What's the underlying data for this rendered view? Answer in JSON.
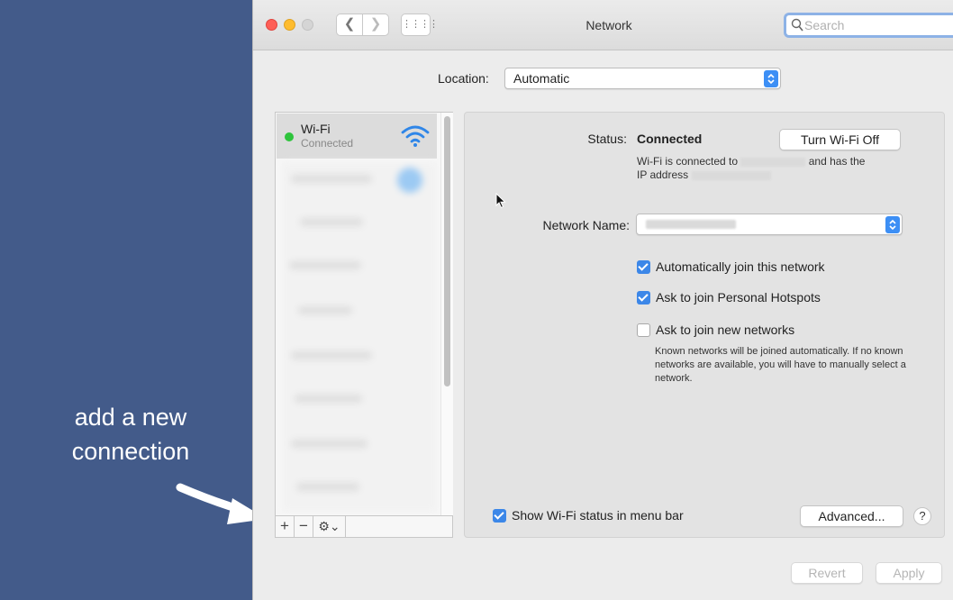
{
  "annotation": {
    "text_line1": "add a new",
    "text_line2": "connection"
  },
  "window": {
    "title": "Network",
    "search_placeholder": "Search"
  },
  "location": {
    "label": "Location:",
    "value": "Automatic"
  },
  "sidebar": {
    "services": [
      {
        "name": "Wi-Fi",
        "status": "Connected",
        "status_color": "#2ec43c",
        "icon": "wifi-icon"
      }
    ],
    "add_label": "+",
    "remove_label": "−",
    "gear_label": "⚙⌄"
  },
  "detail": {
    "status_label": "Status:",
    "status_value": "Connected",
    "turn_off_label": "Turn Wi-Fi Off",
    "desc_part1": "Wi-Fi is connected to",
    "desc_part2": "and has the",
    "desc_part3": "IP address",
    "network_name_label": "Network Name:",
    "checkboxes": [
      {
        "label": "Automatically join this network",
        "checked": true
      },
      {
        "label": "Ask to join Personal Hotspots",
        "checked": true
      },
      {
        "label": "Ask to join new networks",
        "checked": false
      }
    ],
    "note": "Known networks will be joined automatically. If no known networks are available, you will have to manually select a network.",
    "show_status_label": "Show Wi-Fi status in menu bar",
    "show_status_checked": true,
    "advanced_label": "Advanced...",
    "help_label": "?"
  },
  "footer": {
    "revert_label": "Revert",
    "apply_label": "Apply"
  },
  "colors": {
    "background": "#435b8a",
    "accent": "#3c87e8",
    "wifi_blue": "#2f86e8"
  }
}
